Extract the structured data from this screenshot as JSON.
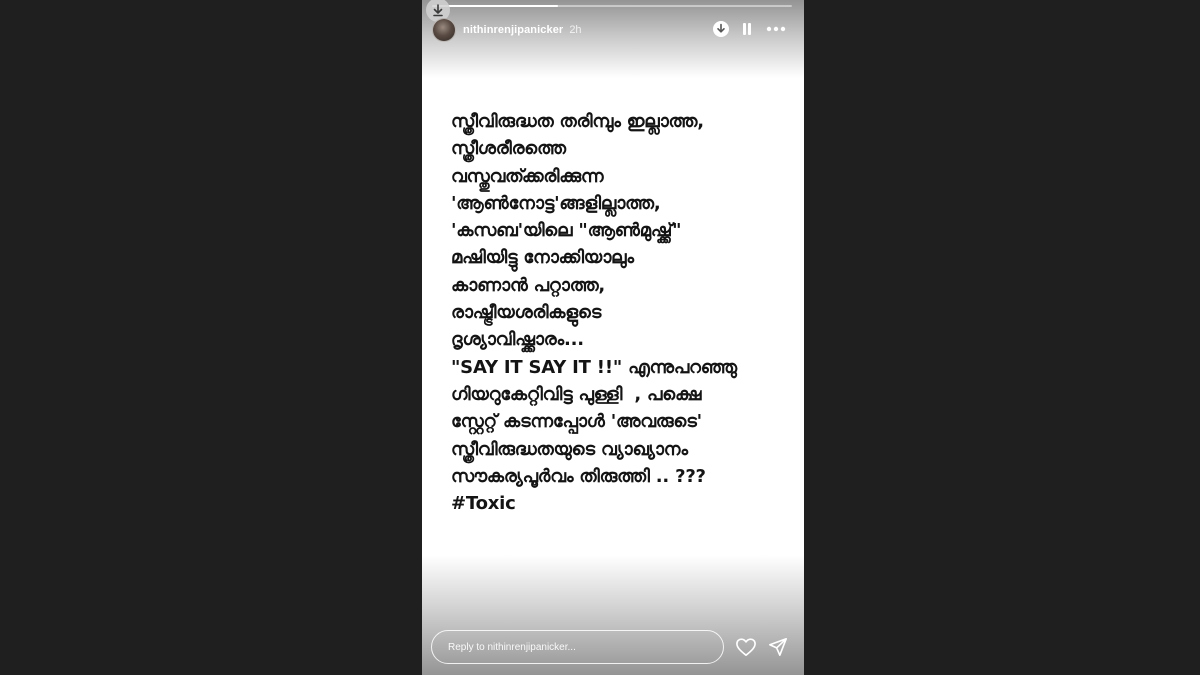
{
  "story": {
    "progress": 0.35,
    "username": "nithinrenjipanicker",
    "time_ago": "2h",
    "text": "സ്ത്രീവിരുദ്ധത തരിമ്പും ഇല്ലാത്ത,\nസ്ത്രീശരീരത്തെ\nവസ്തുവത്ക്കരിക്കുന്ന\n'ആൺനോട്ട'ങ്ങളില്ലാത്ത,\n'കസബ'യിലെ \"ആൺമുഷ്ക്ക്\"\nമഷിയിട്ടു നോക്കിയാലും\nകാണാൻ പറ്റാത്ത,\nരാഷ്ട്രീയശരികളുടെ\nദൃശ്യാവിഷ്ക്കാരം...\n\"SAY IT SAY IT !!\" എന്നുപറഞ്ഞു\nഗിയറുകേറ്റിവിട്ട പുള്ളി  , പക്ഷെ\nസ്റ്റേറ്റ് കടന്നപ്പോൾ 'അവരുടെ'\nസ്ത്രീവിരുദ്ധതയുടെ വ്യാഖ്യാനം\nസൗകര്യപൂർവം തിരുത്തി .. ???\n#Toxic"
  },
  "reply": {
    "placeholder": "Reply to nithinrenjipanicker..."
  },
  "icons": {
    "download": "download-icon",
    "save": "save-icon",
    "pause": "pause-icon",
    "more": "more-icon",
    "like": "heart-icon",
    "share": "send-icon"
  },
  "colors": {
    "backdrop": "#1f1f1f",
    "story_background": "#ffffff",
    "text": "#141414",
    "overlay_text": "#ffffff"
  }
}
